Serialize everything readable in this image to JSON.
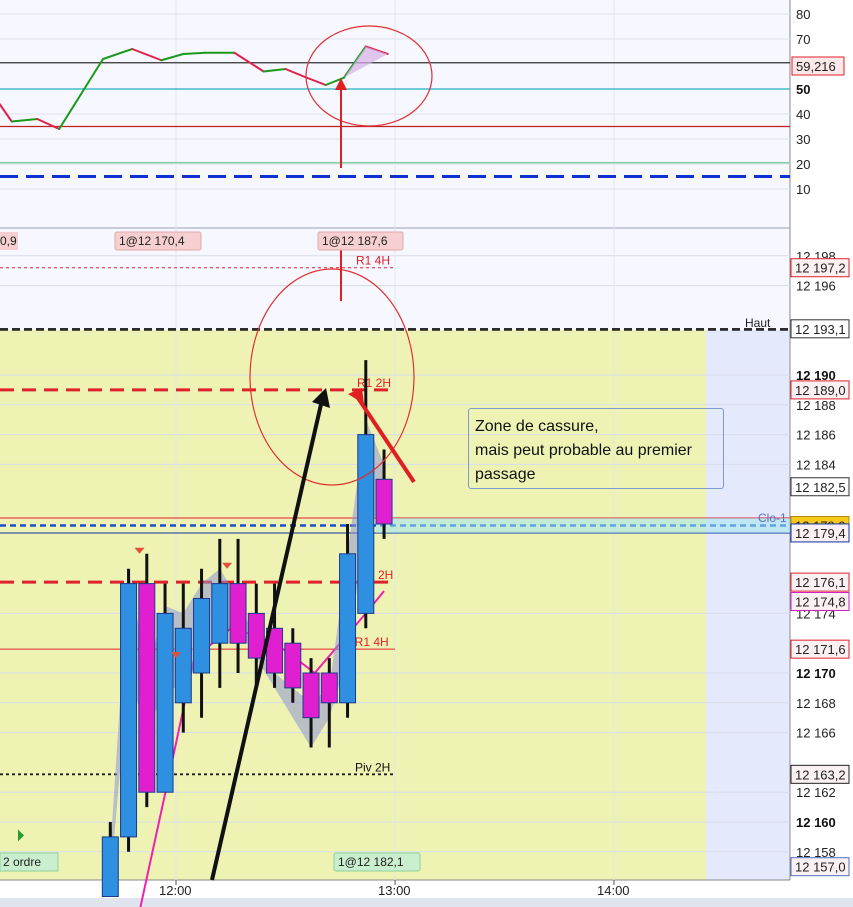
{
  "chart_data": [
    {
      "type": "line",
      "panel": "oscillator",
      "ylim": [
        0,
        85
      ],
      "yticks": [
        {
          "v": 80,
          "label": "80",
          "bold": false
        },
        {
          "v": 70,
          "label": "70",
          "bold": false
        },
        {
          "v": 50,
          "label": "50",
          "bold": true
        },
        {
          "v": 40,
          "label": "40",
          "bold": false
        },
        {
          "v": 30,
          "label": "30",
          "bold": false
        },
        {
          "v": 20,
          "label": "20",
          "bold": false
        },
        {
          "v": 10,
          "label": "10",
          "bold": false
        }
      ],
      "value_tag": {
        "v": 59.2,
        "label": "59,216",
        "color": "#e0202a"
      },
      "levels": [
        {
          "v": 60.5,
          "color": "#303030",
          "style": "solid"
        },
        {
          "v": 50,
          "color": "#20b0c0",
          "style": "solid"
        },
        {
          "v": 35,
          "color": "#c02020",
          "style": "solid"
        },
        {
          "v": 20.5,
          "color": "#70c890",
          "style": "solid"
        },
        {
          "v": 15,
          "color": "#1030d0",
          "style": "dashed"
        }
      ],
      "series": [
        {
          "times": [
            "10:52",
            "10:58",
            "11:05",
            "11:10",
            "11:15",
            "11:22",
            "11:28",
            "11:34",
            "11:40",
            "11:48",
            "11:56",
            "12:02",
            "12:08",
            "12:16",
            "12:24",
            "12:30",
            "12:35",
            "12:41",
            "12:46",
            "12:52",
            "12:58"
          ],
          "values": [
            45,
            47,
            48,
            47.5,
            37,
            38,
            34,
            48,
            62,
            66,
            61.5,
            64,
            64.5,
            64.5,
            57,
            58,
            55,
            51.6,
            54.5,
            67,
            64
          ]
        }
      ]
    },
    {
      "type": "candlestick",
      "panel": "price",
      "ylim": [
        12155.5,
        12199.6
      ],
      "x_axis": {
        "ticks": [
          "12:00",
          "13:00",
          "14:00"
        ]
      },
      "yticks": [
        {
          "v": 12198,
          "label": "12 198",
          "bold": false
        },
        {
          "v": 12196,
          "label": "12 196",
          "bold": false
        },
        {
          "v": 12190,
          "label": "12 190",
          "bold": true
        },
        {
          "v": 12188,
          "label": "12 188",
          "bold": false
        },
        {
          "v": 12186,
          "label": "12 186",
          "bold": false
        },
        {
          "v": 12184,
          "label": "12 184",
          "bold": false
        },
        {
          "v": 12174,
          "label": "12 174",
          "bold": false
        },
        {
          "v": 12170,
          "label": "12 170",
          "bold": true
        },
        {
          "v": 12168,
          "label": "12 168",
          "bold": false
        },
        {
          "v": 12166,
          "label": "12 166",
          "bold": false
        },
        {
          "v": 12162,
          "label": "12 162",
          "bold": false
        },
        {
          "v": 12160,
          "label": "12 160",
          "bold": true
        },
        {
          "v": 12158,
          "label": "12 158",
          "bold": false
        }
      ],
      "candles": [
        {
          "t": "11:42",
          "o": 12155,
          "h": 12160,
          "l": 12155,
          "c": 12159
        },
        {
          "t": "11:47",
          "o": 12159,
          "h": 12177,
          "l": 12158,
          "c": 12176
        },
        {
          "t": "11:52",
          "o": 12176,
          "h": 12178,
          "l": 12161,
          "c": 12162
        },
        {
          "t": "11:57",
          "o": 12162,
          "h": 12176,
          "l": 12163,
          "c": 12174
        },
        {
          "t": "12:02",
          "o": 12168,
          "h": 12176,
          "l": 12166,
          "c": 12173
        },
        {
          "t": "12:07",
          "o": 12170,
          "h": 12177,
          "l": 12167,
          "c": 12175
        },
        {
          "t": "12:12",
          "o": 12172,
          "h": 12179,
          "l": 12169,
          "c": 12176
        },
        {
          "t": "12:17",
          "o": 12176,
          "h": 12179,
          "l": 12170,
          "c": 12172
        },
        {
          "t": "12:22",
          "o": 12174,
          "h": 12176,
          "l": 12169,
          "c": 12171
        },
        {
          "t": "12:27",
          "o": 12173,
          "h": 12176,
          "l": 12169,
          "c": 12170
        },
        {
          "t": "12:32",
          "o": 12172,
          "h": 12173,
          "l": 12168,
          "c": 12169
        },
        {
          "t": "12:37",
          "o": 12170,
          "h": 12171,
          "l": 12165,
          "c": 12167
        },
        {
          "t": "12:42",
          "o": 12170,
          "h": 12171,
          "l": 12165,
          "c": 12168
        },
        {
          "t": "12:47",
          "o": 12168,
          "h": 12180,
          "l": 12167,
          "c": 12178
        },
        {
          "t": "12:52",
          "o": 12174,
          "h": 12191,
          "l": 12173,
          "c": 12186
        },
        {
          "t": "12:57",
          "o": 12183,
          "h": 12185,
          "l": 12179,
          "c": 12180
        }
      ],
      "levels": [
        {
          "v": 12197.2,
          "label": "12 197,2",
          "color": "#e0202a",
          "style": "dotted",
          "name": "R1 4H"
        },
        {
          "v": 12193.1,
          "label": "12 193,1",
          "color": "#303030",
          "style": "dashed",
          "name": "Haut"
        },
        {
          "v": 12189.0,
          "label": "12 189,0",
          "color": "#e0202a",
          "style": "dashed-thick",
          "name": "R1 2H"
        },
        {
          "v": 12182.5,
          "label": "12 182,5",
          "color": "#303030",
          "style": "none",
          "name": ""
        },
        {
          "v": 12180.4,
          "label": "",
          "color": "#e0202a",
          "style": "solid",
          "name": ""
        },
        {
          "v": 12179.9,
          "label": "12 179,9",
          "color": "#1a50d0",
          "style": "dotted-thick",
          "name": "Clo-1"
        },
        {
          "v": 12179.4,
          "label": "12 179,4",
          "color": "#1030a0",
          "style": "solid",
          "name": ""
        },
        {
          "v": 12176.1,
          "label": "12 176,1",
          "color": "#e0202a",
          "style": "dashed-thick",
          "name": "1 2H"
        },
        {
          "v": 12174.8,
          "label": "12 174,8",
          "color": "#d020c0",
          "style": "none",
          "name": ""
        },
        {
          "v": 12171.6,
          "label": "12 171,6",
          "color": "#e0202a",
          "style": "solid",
          "name": "nR1 4H"
        },
        {
          "v": 12163.2,
          "label": "12 163,2",
          "color": "#202020",
          "style": "dotted",
          "name": "Piv 2H"
        },
        {
          "v": 12157.0,
          "label": "12 157,0",
          "color": "#5070c0",
          "style": "none",
          "name": ""
        }
      ],
      "last_price": {
        "v": 12179.9,
        "label": "12 179,9"
      }
    }
  ],
  "trade_tags": [
    {
      "label": "1@12 170,4"
    },
    {
      "label": "1@12 187,6"
    },
    {
      "label": "1@12 182,1"
    }
  ],
  "cut_labels": {
    "left_top": "0,9",
    "left_bottom": "2 ordre",
    "haut": "Haut",
    "clo": "Clo-1"
  },
  "annotation": {
    "line1": "Zone de cassure,",
    "line2": "mais peut probable au premier",
    "line3": "passage"
  },
  "colors": {
    "bull": "#2f8fe0",
    "bear": "#e020d0",
    "zone_fill": "#eef3b4",
    "osc_up": "#1a9a1a",
    "osc_down": "#e0204a",
    "highlight_circle": "#e03030"
  }
}
